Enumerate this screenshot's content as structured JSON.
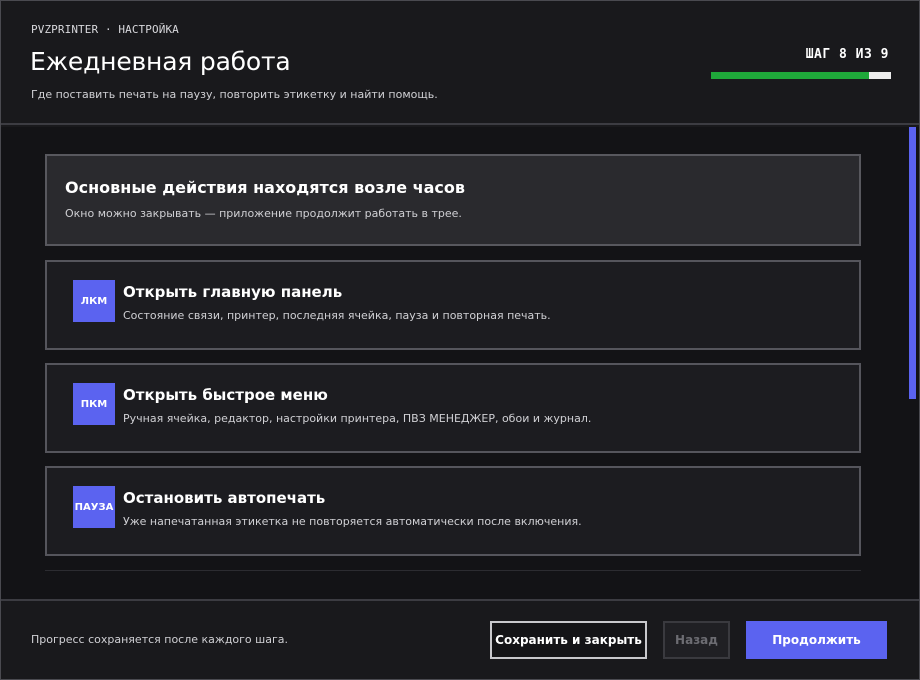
{
  "header": {
    "breadcrumb": "PVZPRINTER · НАСТРОЙКА",
    "title": "Ежедневная работа",
    "subtitle": "Где поставить печать на паузу, повторить этикетку и найти помощь.",
    "step_label": "ШАГ 8 ИЗ 9",
    "step_current": 8,
    "step_total": 9,
    "progress_fraction": 0.875
  },
  "intro": {
    "title": "Основные действия находятся возле часов",
    "text": "Окно можно закрывать — приложение продолжит работать в трее."
  },
  "actions": [
    {
      "badge": "ЛКМ",
      "title": "Открыть главную панель",
      "text": "Состояние связи, принтер, последняя ячейка, пауза и повторная печать."
    },
    {
      "badge": "ПКМ",
      "title": "Открыть быстрое меню",
      "text": "Ручная ячейка, редактор, настройки принтера, ПВЗ МЕНЕДЖЕР, обои и журнал."
    },
    {
      "badge": "ПАУЗА",
      "title": "Остановить автопечать",
      "text": "Уже напечатанная этикетка не повторяется автоматически после включения."
    }
  ],
  "footer": {
    "note": "Прогресс сохраняется после каждого шага.",
    "save_label": "Сохранить и закрыть",
    "back_label": "Назад",
    "next_label": "Продолжить"
  },
  "colors": {
    "accent": "#5b63f0",
    "progress": "#1fa83a",
    "background": "#19191c"
  }
}
